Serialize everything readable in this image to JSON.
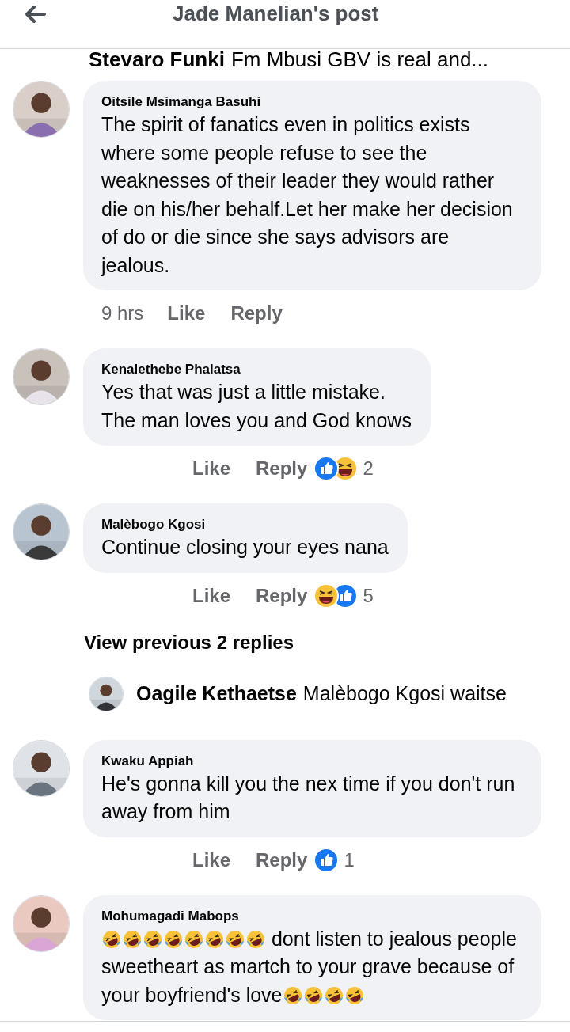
{
  "header": {
    "title": "Jade Manelian's post"
  },
  "top_reply": {
    "author": "Stevaro Funki",
    "text": "Fm Mbusi GBV is real and..."
  },
  "comments": [
    {
      "kind": "comment",
      "author": "Oitsile Msimanga Basuhi",
      "body": [
        {
          "kind": "text",
          "text": "The spirit of fanatics even in politics exists where some people refuse to see the weaknesses of their leader they would rather die on his/her behalf.Let her make her decision of do or die since she says advisors are jealous."
        }
      ],
      "time": "9 hrs",
      "like": "Like",
      "reply": "Reply"
    },
    {
      "kind": "comment",
      "author": "Kenalethebe Phalatsa",
      "body": [
        {
          "kind": "text",
          "text": "Yes that was just a little mistake.\nThe man loves you and God knows"
        }
      ],
      "like": "Like",
      "reply": "Reply",
      "reactions": [
        {
          "kind": "like"
        },
        {
          "kind": "haha"
        }
      ],
      "count": "2"
    },
    {
      "kind": "comment",
      "author": "Malèbogo Kgosi",
      "body": [
        {
          "kind": "text",
          "text": "Continue closing your eyes nana"
        }
      ],
      "like": "Like",
      "reply": "Reply",
      "reactions": [
        {
          "kind": "haha"
        },
        {
          "kind": "like"
        }
      ],
      "count": "5"
    },
    {
      "kind": "more",
      "text": "View previous 2 replies"
    },
    {
      "kind": "reply",
      "author": "Oagile Kethaetse",
      "text": "Malèbogo Kgosi waitse"
    },
    {
      "kind": "comment",
      "author": "Kwaku Appiah",
      "body": [
        {
          "kind": "text",
          "text": "He's gonna kill you the nex time if you don't run away from him"
        }
      ],
      "like": "Like",
      "reply": "Reply",
      "reactions": [
        {
          "kind": "like"
        }
      ],
      "count": "1"
    },
    {
      "kind": "comment",
      "author": "Mohumagadi Mabops",
      "body": [
        {
          "kind": "emoji"
        },
        {
          "kind": "emoji"
        },
        {
          "kind": "emoji"
        },
        {
          "kind": "emoji"
        },
        {
          "kind": "emoji"
        },
        {
          "kind": "emoji"
        },
        {
          "kind": "emoji"
        },
        {
          "kind": "emoji"
        },
        {
          "kind": "text",
          "text": " dont listen to jealous people sweetheart as martch to your grave because of your boyfriend's love"
        },
        {
          "kind": "emoji"
        },
        {
          "kind": "emoji"
        },
        {
          "kind": "emoji"
        },
        {
          "kind": "emoji"
        }
      ]
    }
  ]
}
